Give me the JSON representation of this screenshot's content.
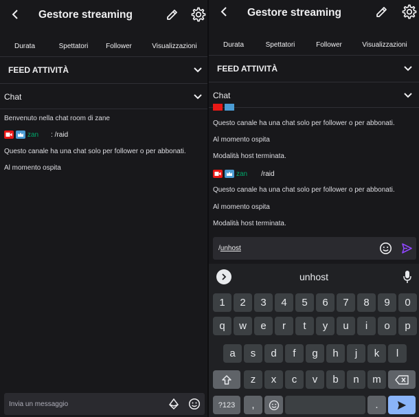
{
  "colors": {
    "background": "#18181b",
    "accent": "#9147ff",
    "username": "#00a86b",
    "badge_red": "#e91916",
    "badge_blue": "#4b9cd3",
    "keyboard_bg": "#202124",
    "key_bg": "#3c4043",
    "enter_key": "#8ab4f8"
  },
  "left": {
    "header": {
      "title": "Gestore streaming",
      "back_icon": "chevron-left-icon",
      "edit_icon": "pencil-icon",
      "settings_icon": "gear-icon"
    },
    "tabs": [
      "Durata",
      "Spettatori",
      "Follower",
      "Visualizzazioni"
    ],
    "feed_label": "FEED ATTIVITÀ",
    "chat_label": "Chat",
    "messages": {
      "welcome": "Benvenuto nella chat room di zane",
      "raid_user": "zan",
      "raid_text": ": /raid",
      "follower_only": "Questo canale ha una chat solo per follower o per abbonati.",
      "hosting": "Al momento ospita"
    },
    "input": {
      "placeholder": "Invia un messaggio"
    }
  },
  "right": {
    "header": {
      "title": "Gestore streaming",
      "back_icon": "chevron-left-icon",
      "edit_icon": "pencil-icon",
      "settings_icon": "gear-icon"
    },
    "tabs": [
      "Durata",
      "Spettatori",
      "Follower",
      "Visualizzazioni"
    ],
    "feed_label": "FEED ATTIVITÀ",
    "chat_label": "Chat",
    "messages": {
      "follower_only_1": "Questo canale ha una chat solo per follower o per abbonati.",
      "hosting_1": "Al momento ospita",
      "host_ended_1": "Modalità host terminata.",
      "raid_user": "zan",
      "raid_text": "/raid",
      "follower_only_2": "Questo canale ha una chat solo per follower o per abbonati.",
      "hosting_2": "Al momento ospita",
      "host_ended_2": "Modalità host terminata."
    },
    "input": {
      "value_prefix": "/",
      "value_word": "unhost"
    },
    "keyboard": {
      "suggestion": "unhost",
      "row_numbers": [
        "1",
        "2",
        "3",
        "4",
        "5",
        "6",
        "7",
        "8",
        "9",
        "0"
      ],
      "row_1": [
        "q",
        "w",
        "e",
        "r",
        "t",
        "y",
        "u",
        "i",
        "o",
        "p"
      ],
      "row_2": [
        "a",
        "s",
        "d",
        "f",
        "g",
        "h",
        "j",
        "k",
        "l"
      ],
      "row_3": [
        "z",
        "x",
        "c",
        "v",
        "b",
        "n",
        "m"
      ],
      "symbols_key": "?123",
      "comma_key": ",",
      "period_key": "."
    }
  }
}
